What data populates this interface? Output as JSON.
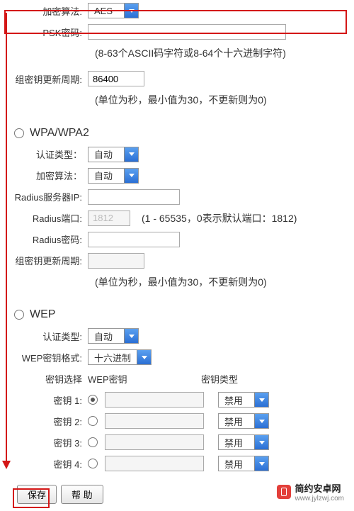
{
  "top": {
    "encrypt_algo_label": "加密算法:",
    "encrypt_algo_value": "AES",
    "psk_label": "PSK密码:",
    "psk_value": "",
    "psk_hint": "(8-63个ASCII码字符或8-64个十六进制字符)",
    "group_rekey_label": "组密钥更新周期:",
    "group_rekey_value": "86400",
    "group_rekey_hint": "(单位为秒，最小值为30，不更新则为0)"
  },
  "wpa": {
    "section": "WPA/WPA2",
    "auth_label": "认证类型：",
    "auth_value": "自动",
    "algo_label": "加密算法：",
    "algo_value": "自动",
    "radius_ip_label": "Radius服务器IP:",
    "radius_ip_value": "",
    "radius_port_label": "Radius端口:",
    "radius_port_value": "1812",
    "radius_port_hint": "(1 - 65535，0表示默认端口：1812)",
    "radius_pw_label": "Radius密码:",
    "radius_pw_value": "",
    "group_rekey_label": "组密钥更新周期:",
    "group_rekey_value": "",
    "group_rekey_hint": "(单位为秒，最小值为30，不更新则为0)"
  },
  "wep": {
    "section": "WEP",
    "auth_label": "认证类型:",
    "auth_value": "自动",
    "format_label": "WEP密钥格式:",
    "format_value": "十六进制",
    "col_select": "密钥选择",
    "col_key": "WEP密钥",
    "col_type": "密钥类型",
    "keys": [
      {
        "label": "密钥 1:",
        "value": "",
        "type": "禁用",
        "selected": true
      },
      {
        "label": "密钥 2:",
        "value": "",
        "type": "禁用",
        "selected": false
      },
      {
        "label": "密钥 3:",
        "value": "",
        "type": "禁用",
        "selected": false
      },
      {
        "label": "密钥 4:",
        "value": "",
        "type": "禁用",
        "selected": false
      }
    ]
  },
  "buttons": {
    "save": "保存",
    "help": "帮 助"
  },
  "watermark": {
    "title": "简约安卓网",
    "url": "www.jylzwj.com"
  }
}
